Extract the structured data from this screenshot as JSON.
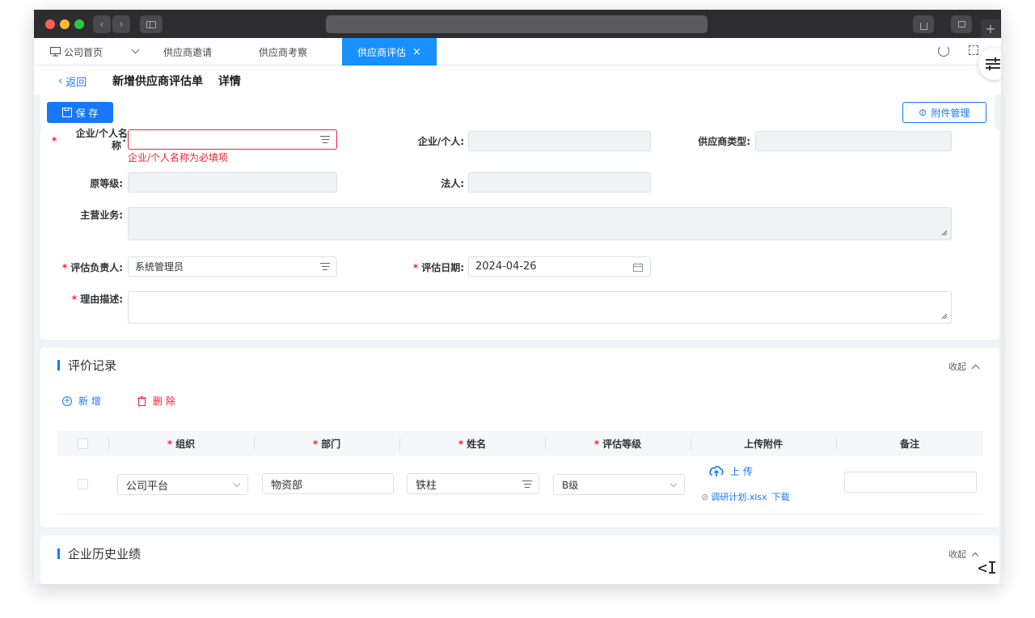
{
  "browser": {
    "colors": {
      "close": "#ff5f57",
      "minimize": "#febc2e",
      "maximize": "#28c840"
    }
  },
  "tabs": {
    "home": "公司首页",
    "items": [
      {
        "label": "供应商邀请"
      },
      {
        "label": "供应商考察"
      },
      {
        "label": "供应商评估",
        "active": true
      }
    ],
    "close_glyph": "×"
  },
  "header": {
    "back_label": "返回",
    "title": "新增供应商评估单",
    "subtitle": "详情"
  },
  "toolbar": {
    "save_label": "保 存",
    "attachments_label": "附件管理"
  },
  "form": {
    "company_name": {
      "label_line1": "企业/个人名",
      "label_line2": "称",
      "value": "",
      "error": "企业/个人名称为必填项",
      "required": true
    },
    "entity_type": {
      "label": "企业/个人:",
      "value": ""
    },
    "supplier_type": {
      "label": "供应商类型:",
      "value": ""
    },
    "original_level": {
      "label": "原等级:",
      "value": ""
    },
    "legal_person": {
      "label": "法人:",
      "value": ""
    },
    "main_business": {
      "label": "主营业务:",
      "value": ""
    },
    "evaluator": {
      "label": "评估负责人:",
      "value": "系统管理员",
      "required": true
    },
    "eval_date": {
      "label": "评估日期:",
      "value": "2024-04-26",
      "required": true
    },
    "reason": {
      "label": "理由描述:",
      "value": "",
      "required": true
    }
  },
  "eval_records": {
    "title": "评价记录",
    "collapse_label": "收起",
    "add_label": "新 增",
    "delete_label": "删 除",
    "columns": [
      {
        "label": "组织",
        "required": true
      },
      {
        "label": "部门",
        "required": true
      },
      {
        "label": "姓名",
        "required": true
      },
      {
        "label": "评估等级",
        "required": true
      },
      {
        "label": "上传附件",
        "required": false
      },
      {
        "label": "备注",
        "required": false
      }
    ],
    "rows": [
      {
        "org": "公司平台",
        "dept": "物资部",
        "name": "铁柱",
        "grade": "B级",
        "upload_label": "上 传",
        "file": "调研计划.xlsx",
        "download_label": "下载",
        "remark": ""
      }
    ]
  },
  "history": {
    "title": "企业历史业绩",
    "collapse_label": "收起"
  }
}
